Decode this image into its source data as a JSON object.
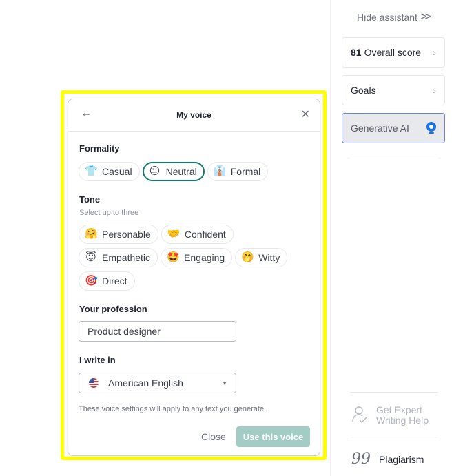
{
  "sidebar": {
    "hide_assistant": "Hide assistant",
    "hide_icon": "double-chevron-right",
    "score": {
      "value": "81",
      "label": "Overall score"
    },
    "goals": "Goals",
    "generative_ai": "Generative AI",
    "expert_help": {
      "line1": "Get Expert",
      "line2": "Writing Help"
    },
    "plagiarism": "Plagiarism",
    "accent_color": "#1a73e8"
  },
  "dialog": {
    "title": "My voice",
    "formality": {
      "label": "Formality",
      "options": [
        {
          "emoji": "👕",
          "label": "Casual",
          "selected": false
        },
        {
          "emoji": "😐",
          "label": "Neutral",
          "selected": true
        },
        {
          "emoji": "👔",
          "label": "Formal",
          "selected": false
        }
      ]
    },
    "tone": {
      "label": "Tone",
      "sublabel": "Select up to three",
      "options": [
        {
          "emoji": "🤗",
          "label": "Personable"
        },
        {
          "emoji": "🤝",
          "label": "Confident"
        },
        {
          "emoji": "😇",
          "label": "Empathetic"
        },
        {
          "emoji": "🤩",
          "label": "Engaging"
        },
        {
          "emoji": "🤭",
          "label": "Witty"
        },
        {
          "emoji": "🎯",
          "label": "Direct"
        }
      ]
    },
    "profession": {
      "label": "Your profession",
      "value": "Product designer"
    },
    "language": {
      "label": "I write in",
      "value": "American English"
    },
    "footnote": "These voice settings will apply to any text you generate.",
    "close_label": "Close",
    "use_label": "Use this voice",
    "selected_color": "#15796b",
    "use_button_color": "#a3ccc4"
  }
}
